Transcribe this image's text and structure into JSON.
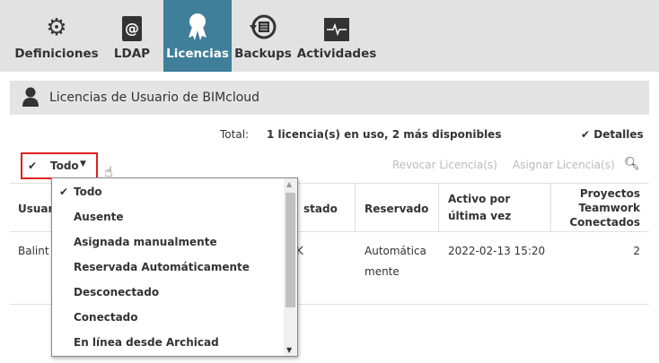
{
  "nav": {
    "tabs": [
      {
        "label": "Definiciones",
        "icon": "gear-icon"
      },
      {
        "label": "LDAP",
        "icon": "address-book-icon"
      },
      {
        "label": "Licencias",
        "icon": "ribbon-icon"
      },
      {
        "label": "Backups",
        "icon": "backup-icon"
      },
      {
        "label": "Actividades",
        "icon": "activity-icon"
      }
    ],
    "active": "Licencias",
    "accent": "#3f7f9a"
  },
  "header": {
    "title": "Licencias de Usuario de BIMcloud"
  },
  "summary": {
    "label": "Total:",
    "value": "1 licencia(s) en uso, 2 más disponibles",
    "details": "Detalles"
  },
  "toolbar": {
    "filter": "Todo",
    "revoke": "Revocar Licencia(s)",
    "assign": "Asignar Licencia(s)"
  },
  "table": {
    "headers": [
      "Usuar",
      "stado",
      "Reservado",
      "Activo por",
      "última vez",
      "Proyectos",
      "Teamwork",
      "Conectados"
    ],
    "row": {
      "user": "Balint",
      "state": "K",
      "reserved1": "Automática",
      "reserved2": "mente",
      "active": "2022-02-13 15:20",
      "projects": "2"
    }
  },
  "dropdown": {
    "options": [
      "Todo",
      "Ausente",
      "Asignada manualmente",
      "Reservada Automáticamente",
      "Desconectado",
      "Conectado",
      "En línea desde Archicad"
    ],
    "selected": "Todo"
  }
}
